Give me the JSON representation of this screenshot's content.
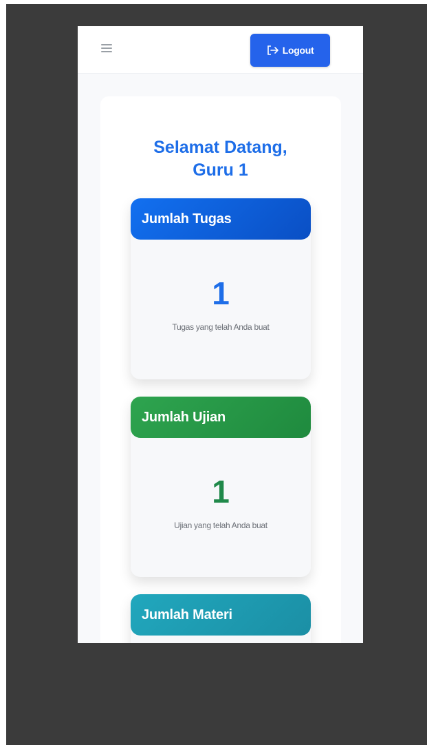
{
  "topbar": {
    "menu_icon": "hamburger-menu-icon",
    "logout_icon": "logout-icon",
    "logout_label": "Logout"
  },
  "welcome": {
    "line1": "Selamat Datang,",
    "line2": "Guru 1"
  },
  "stats": [
    {
      "title": "Jumlah Tugas",
      "value": "1",
      "description": "Tugas yang telah Anda buat",
      "color": "#1e6ee8"
    },
    {
      "title": "Jumlah Ujian",
      "value": "1",
      "description": "Ujian yang telah Anda buat",
      "color": "#20894a"
    },
    {
      "title": "Jumlah Materi",
      "color": "#21a7bd"
    }
  ],
  "colors": {
    "backdrop": "#3b3b3b",
    "primary": "#2563eb"
  }
}
